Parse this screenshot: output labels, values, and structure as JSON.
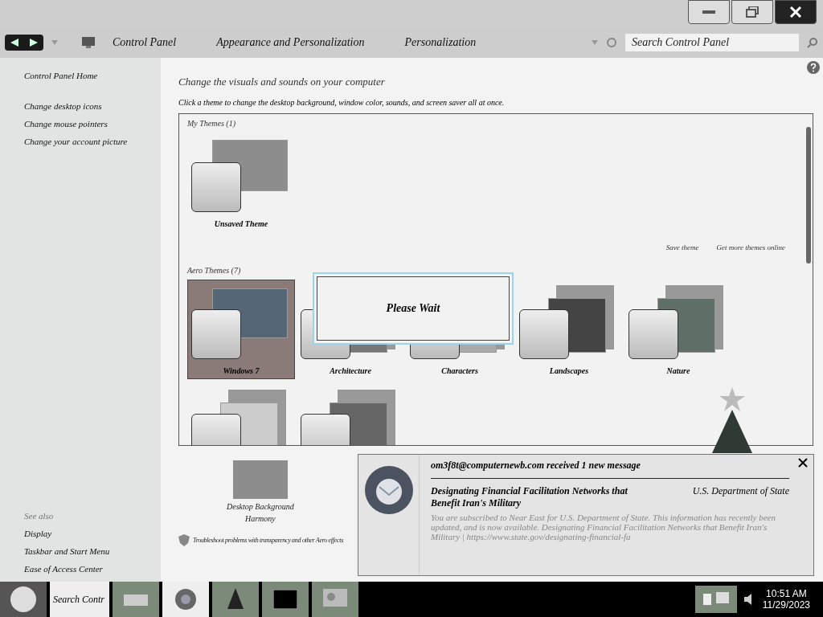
{
  "breadcrumb": [
    "Control Panel",
    "Appearance and Personalization",
    "Personalization"
  ],
  "search": {
    "placeholder": "Search Control Panel"
  },
  "sidebar": {
    "links": [
      "Control Panel Home",
      "Change desktop icons",
      "Change mouse pointers",
      "Change your account picture"
    ],
    "see_also_heading": "See also",
    "see_also": [
      "Display",
      "Taskbar and Start Menu",
      "Ease of Access Center"
    ]
  },
  "heading": "Change the visuals and sounds on your computer",
  "subheading": "Click a theme to change the desktop background, window color, sounds, and screen saver all at once.",
  "my_themes": {
    "title": "My Themes (1)",
    "themes": [
      {
        "name": "Unsaved Theme",
        "selected": false
      }
    ]
  },
  "actions": [
    "Save theme",
    "Get more themes online"
  ],
  "aero_themes": {
    "title": "Aero Themes (7)",
    "themes": [
      {
        "name": "Windows 7",
        "selected": true
      },
      {
        "name": "Architecture",
        "selected": false
      },
      {
        "name": "Characters",
        "selected": false
      },
      {
        "name": "Landscapes",
        "selected": false
      },
      {
        "name": "Nature",
        "selected": false
      },
      {
        "selected": false
      },
      {
        "selected": false
      }
    ]
  },
  "dialog": {
    "text": "Please Wait"
  },
  "settings": [
    {
      "label": "Desktop Background",
      "value": "Harmony"
    }
  ],
  "troubleshoot": "Troubleshoot problems with transparency and other Aero effects",
  "notification": {
    "title": "om3f8t@computernewb.com received 1 new message",
    "subject": "Designating Financial Facilitation Networks that Benefit Iran's Military",
    "source": "U.S. Department of State",
    "body": "You are subscribed to Near East for U.S. Department of State. This information has recently been updated, and is now available. Designating Financial Facilitation Networks that Benefit Iran's Military | https://www.state.gov/designating-financial-fa"
  },
  "taskbar": {
    "tile_text": "Search Contr",
    "time": "10:51 AM",
    "date": "11/29/2023"
  }
}
